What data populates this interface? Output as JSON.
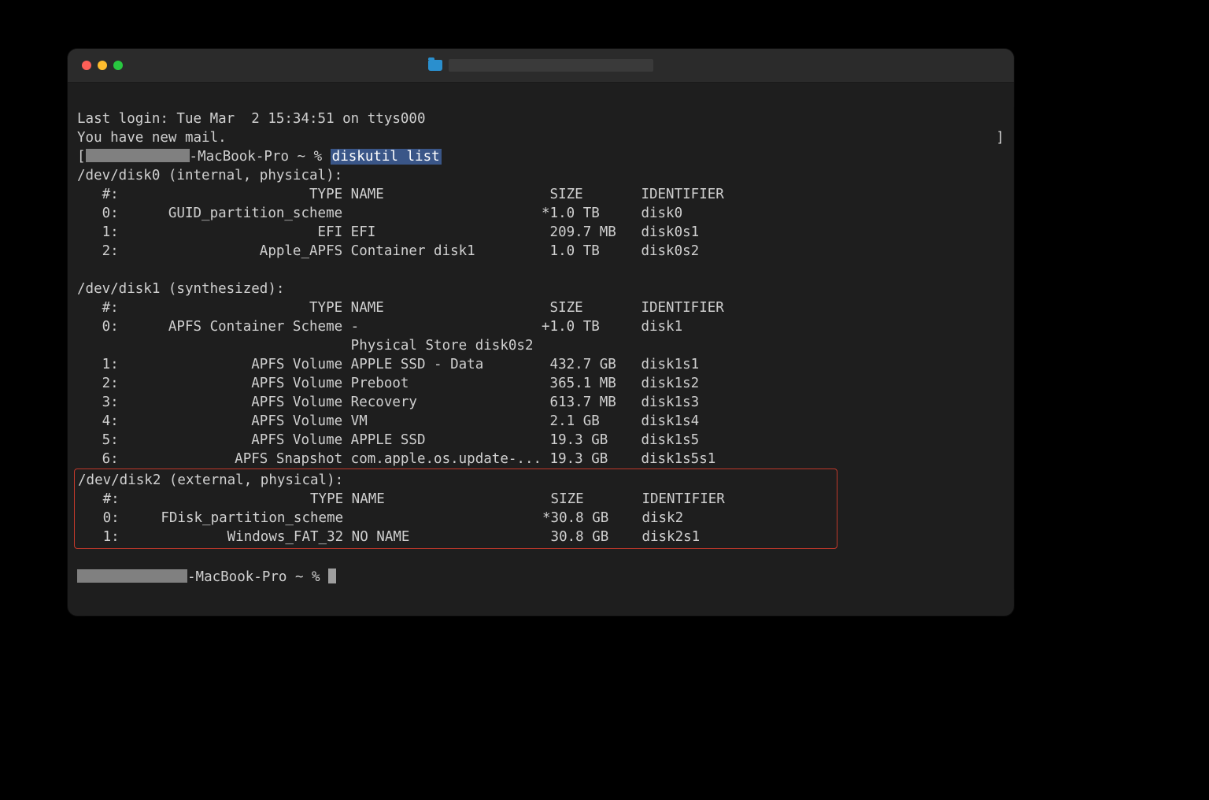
{
  "lastLogin": "Last login: Tue Mar  2 15:34:51 on ttys000",
  "mailNotice": "You have new mail.",
  "promptLeftBracket": "[",
  "promptHost": "-MacBook-Pro ~ % ",
  "command": "diskutil list",
  "rightBracket": "]",
  "disk0Header": "/dev/disk0 (internal, physical):",
  "disk0Col": "   #:                       TYPE NAME                    SIZE       IDENTIFIER",
  "disk0r0": "   0:      GUID_partition_scheme                        *1.0 TB     disk0",
  "disk0r1": "   1:                        EFI EFI                     209.7 MB   disk0s1",
  "disk0r2": "   2:                 Apple_APFS Container disk1         1.0 TB     disk0s2",
  "disk1Header": "/dev/disk1 (synthesized):",
  "disk1Col": "   #:                       TYPE NAME                    SIZE       IDENTIFIER",
  "disk1r0": "   0:      APFS Container Scheme -                      +1.0 TB     disk1",
  "disk1r0b": "                                 Physical Store disk0s2",
  "disk1r1": "   1:                APFS Volume APPLE SSD - Data        432.7 GB   disk1s1",
  "disk1r2": "   2:                APFS Volume Preboot                 365.1 MB   disk1s2",
  "disk1r3": "   3:                APFS Volume Recovery                613.7 MB   disk1s3",
  "disk1r4": "   4:                APFS Volume VM                      2.1 GB     disk1s4",
  "disk1r5": "   5:                APFS Volume APPLE SSD               19.3 GB    disk1s5",
  "disk1r6": "   6:              APFS Snapshot com.apple.os.update-... 19.3 GB    disk1s5s1",
  "disk2Header": "/dev/disk2 (external, physical):",
  "disk2Col": "   #:                       TYPE NAME                    SIZE       IDENTIFIER",
  "disk2r0": "   0:     FDisk_partition_scheme                        *30.8 GB    disk2",
  "disk2r1": "   1:             Windows_FAT_32 NO NAME                 30.8 GB    disk2s1",
  "prompt2Host": "-MacBook-Pro ~ % "
}
